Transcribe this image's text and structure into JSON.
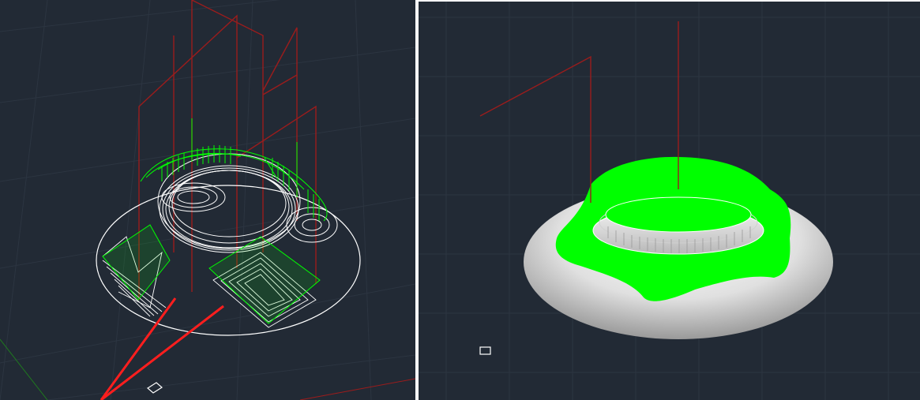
{
  "viewports": [
    {
      "id": "left",
      "view_mode": "wireframe",
      "content": "toolpath-3d-view"
    },
    {
      "id": "right",
      "view_mode": "shaded",
      "content": "toolpath-3d-view"
    }
  ],
  "colors": {
    "background": "#222a35",
    "grid_line": "#2c3541",
    "rapid_move": "#9b1c1c",
    "toolpath_green": "#00ff00",
    "toolpath_white": "#ffffff",
    "stock_gray": "#d9d9d9",
    "axis_red": "#ff1e1e",
    "axis_green": "#1f7a1f",
    "divider": "#ffffff"
  },
  "icons": {
    "ucs_icon": "ucs-icon"
  }
}
